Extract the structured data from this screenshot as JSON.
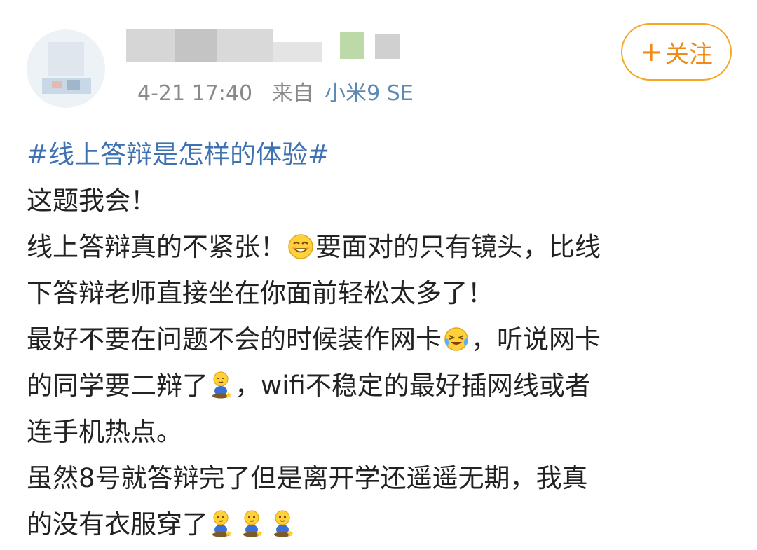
{
  "header": {
    "timestamp": "4-21 17:40",
    "from_label": "来自",
    "source": "小米9 SE",
    "follow": {
      "plus": "+",
      "label": "关注"
    }
  },
  "post": {
    "topic": "#线上答辩是怎样的体验#",
    "line1": "这题我会！",
    "line2a": "线上答辩真的不紧张！",
    "line2b": "要面对的只有镜头，比线",
    "line3": "下答辩老师直接坐在你面前轻松太多了！",
    "line4a": "最好不要在问题不会的时候装作网卡",
    "line4b": "，听说网卡",
    "line5a": "的同学要二辩了",
    "line5b": "，wifi不稳定的最好插网线或者",
    "line6": "连手机热点。",
    "line7": "虽然8号就答辩完了但是离开学还遥遥无期，我真",
    "line8": "的没有衣服穿了"
  },
  "icons": {
    "laugh": "squinting-smile-emoji-icon",
    "cry_laugh": "tears-of-joy-emoji-icon",
    "sit": "sitting-doll-emoji-icon"
  },
  "colors": {
    "topic": "#3f72b0",
    "follow_accent": "#f5a623",
    "meta_text": "#8a8a8a",
    "source_text": "#5d8ab4"
  }
}
